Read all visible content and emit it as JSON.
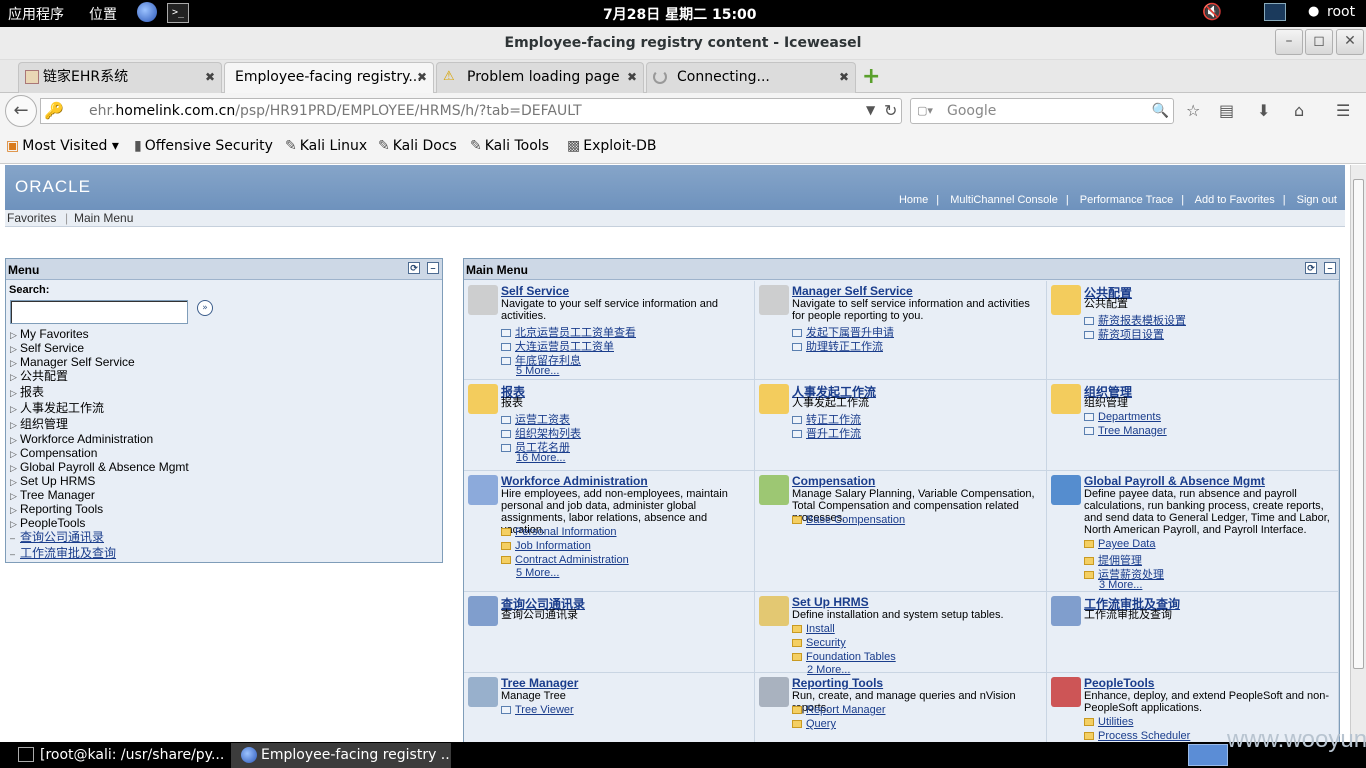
{
  "topbar": {
    "apps": "应用程序",
    "places": "位置",
    "clock": "7月28日 星期二 15:00",
    "user": "root"
  },
  "window": {
    "title": "Employee-facing registry content - Iceweasel"
  },
  "tabs": [
    {
      "label": "链家EHR系统"
    },
    {
      "label": "Employee-facing registry..."
    },
    {
      "label": "Problem loading page"
    },
    {
      "label": "Connecting..."
    }
  ],
  "nav": {
    "url_host_prefix": "ehr.",
    "url_host": "homelink.com.cn",
    "url_path": "/psp/HR91PRD/EMPLOYEE/HRMS/h/?tab=DEFAULT",
    "search_placeholder": "Google"
  },
  "bookmarks": [
    "Most Visited",
    "Offensive Security",
    "Kali Linux",
    "Kali Docs",
    "Kali Tools",
    "Exploit-DB"
  ],
  "ps_header": {
    "logo": "ORACLE",
    "links": [
      "Home",
      "MultiChannel Console",
      "Performance Trace",
      "Add to Favorites",
      "Sign out"
    ],
    "nav": [
      "Favorites",
      "Main Menu"
    ]
  },
  "menu_panel": {
    "title": "Menu",
    "search_label": "Search:",
    "items": [
      {
        "label": "My Favorites"
      },
      {
        "label": "Self Service"
      },
      {
        "label": "Manager Self Service"
      },
      {
        "label": "公共配置"
      },
      {
        "label": "报表"
      },
      {
        "label": "人事发起工作流"
      },
      {
        "label": "组织管理"
      },
      {
        "label": "Workforce Administration"
      },
      {
        "label": "Compensation"
      },
      {
        "label": "Global Payroll & Absence Mgmt"
      },
      {
        "label": "Set Up HRMS"
      },
      {
        "label": "Tree Manager"
      },
      {
        "label": "Reporting Tools"
      },
      {
        "label": "PeopleTools"
      },
      {
        "label": "查询公司通讯录"
      },
      {
        "label": "工作流审批及查询"
      }
    ]
  },
  "main_panel": {
    "title": "Main Menu",
    "cells": [
      {
        "title": "Self Service",
        "desc": "Navigate to your self service information and activities.",
        "links": [
          "北京运营员工工资单查看",
          "大连运营员工工资单",
          "年底留存利息"
        ],
        "more": "5 More..."
      },
      {
        "title": "Manager Self Service",
        "desc": "Navigate to self service information and activities for people reporting to you.",
        "links": [
          "发起下属晋升申请",
          "助理转正工作流"
        ],
        "more": ""
      },
      {
        "title": "公共配置",
        "desc": "公共配置",
        "links": [
          "薪资报表模板设置",
          "薪资项目设置"
        ],
        "more": ""
      },
      {
        "title": "报表",
        "desc": "报表",
        "links": [
          "运营工资表",
          "组织架构列表",
          "员工花名册"
        ],
        "more": "16 More..."
      },
      {
        "title": "人事发起工作流",
        "desc": "人事发起工作流",
        "links": [
          "转正工作流",
          "晋升工作流"
        ],
        "more": ""
      },
      {
        "title": "组织管理",
        "desc": "组织管理",
        "links": [
          "Departments",
          "Tree Manager"
        ],
        "more": ""
      },
      {
        "title": "Workforce Administration",
        "desc": "Hire employees, add non-employees, maintain personal and job data, administer global assignments, labor relations, absence and vacation.",
        "links": [
          "Personal Information",
          "Job Information",
          "Contract Administration"
        ],
        "more": "5 More..."
      },
      {
        "title": "Compensation",
        "desc": "Manage Salary Planning, Variable Compensation, Total Compensation and compensation related processes.",
        "links": [
          "Base Compensation"
        ],
        "more": ""
      },
      {
        "title": "Global Payroll & Absence Mgmt",
        "desc": "Define payee data, run absence and payroll calculations, run banking process, create reports, and send data to General Ledger, Time and Labor, North American Payroll, and Payroll Interface.",
        "links": [
          "Payee Data",
          "提佣管理",
          "运营薪资处理"
        ],
        "more": "3 More..."
      },
      {
        "title": "查询公司通讯录",
        "desc": "查询公司通讯录",
        "links": [],
        "more": ""
      },
      {
        "title": "Set Up HRMS",
        "desc": "Define installation and system setup tables.",
        "links": [
          "Install",
          "Security",
          "Foundation Tables"
        ],
        "more": "2 More..."
      },
      {
        "title": "工作流审批及查询",
        "desc": "工作流审批及查询",
        "links": [],
        "more": ""
      },
      {
        "title": "Tree Manager",
        "desc": "Manage Tree",
        "links": [
          "Tree Viewer"
        ],
        "more": ""
      },
      {
        "title": "Reporting Tools",
        "desc": "Run, create, and manage queries and nVision reports.",
        "links": [
          "Report Manager",
          "Query"
        ],
        "more": ""
      },
      {
        "title": "PeopleTools",
        "desc": "Enhance, deploy, and extend PeopleSoft and non-PeopleSoft applications.",
        "links": [
          "Utilities",
          "Process Scheduler"
        ],
        "more": ""
      }
    ]
  },
  "taskbar": [
    {
      "label": "[root@kali: /usr/share/py..."
    },
    {
      "label": "Employee-facing registry ..."
    }
  ],
  "watermark": "www.wooyun.org"
}
